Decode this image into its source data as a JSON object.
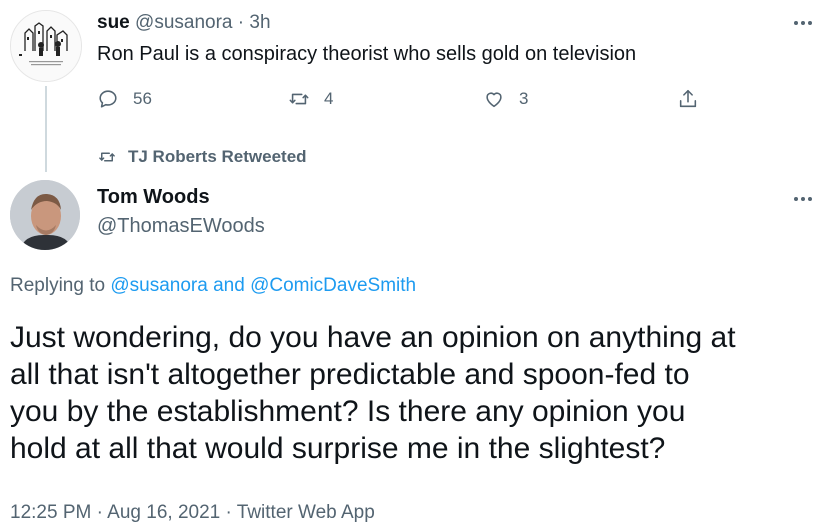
{
  "first_tweet": {
    "author_name": "sue",
    "author_handle": "@susanora",
    "separator": "·",
    "time_ago": "3h",
    "text": "Ron Paul is a conspiracy theorist who sells gold on television",
    "actions": {
      "replies": "56",
      "retweets": "4",
      "likes": "3"
    }
  },
  "retweet_notice": {
    "text": "TJ Roberts Retweeted"
  },
  "main_tweet": {
    "author_name": "Tom Woods",
    "author_handle": "@ThomasEWoods",
    "replying_prefix": "Replying to",
    "replying_user1": "@susanora",
    "replying_and": "and",
    "replying_user2": "@ComicDaveSmith",
    "text_lines": [
      "Just wondering, do you have an opinion on anything at",
      "all that isn't altogether predictable and spoon-fed to",
      "you by the establishment? Is there any opinion you",
      "hold at all that would surprise me in the slightest?"
    ],
    "time": "12:25 PM",
    "sep1": "·",
    "date": "Aug 16, 2021",
    "sep2": "·",
    "source": "Twitter Web App"
  },
  "colors": {
    "text": "#0f1419",
    "muted": "#536471",
    "link": "#1d9bf0",
    "thread_line": "#cfd9de"
  },
  "icons": [
    "reply-icon",
    "retweet-icon",
    "like-icon",
    "share-icon",
    "more-icon"
  ]
}
